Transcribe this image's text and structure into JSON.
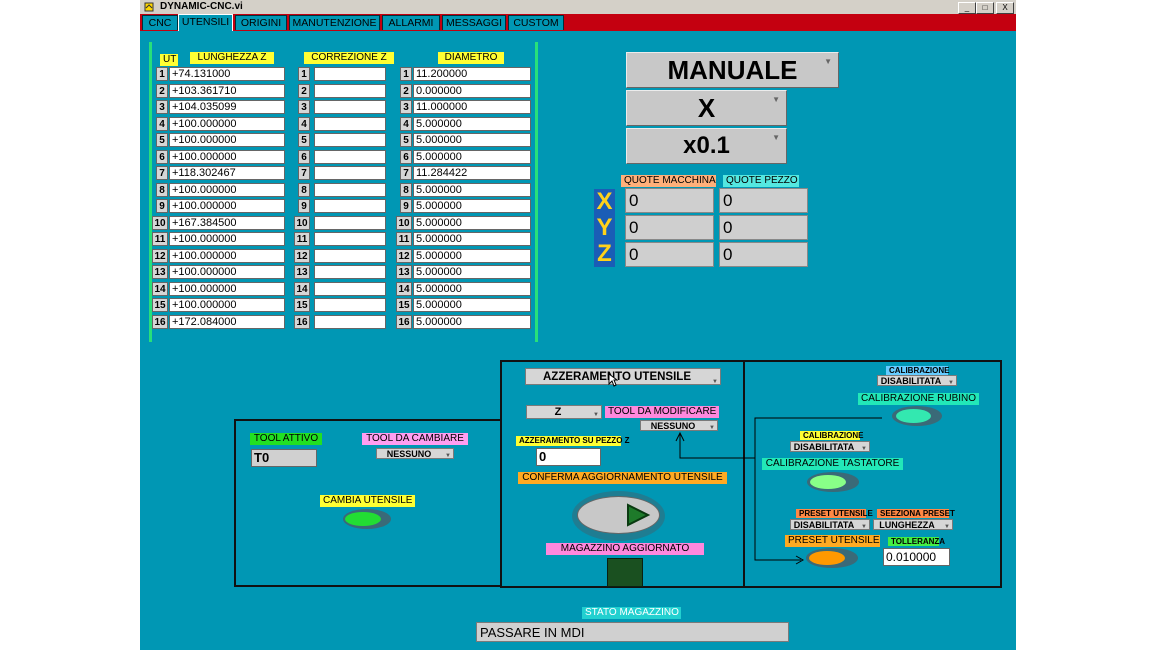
{
  "window": {
    "title": "DYNAMIC-CNC.vi",
    "min": "_",
    "max": "□",
    "close": "X"
  },
  "tabs": [
    "CNC",
    "UTENSILI",
    "ORIGINI",
    "MANUTENZIONE",
    "ALLARMI",
    "MESSAGGI",
    "CUSTOM"
  ],
  "table": {
    "ut_header": "UT",
    "lunghezza_header": "LUNGHEZZA Z",
    "correzione_header": "CORREZIONE Z",
    "diametro_header": "DIAMETRO",
    "rows": [
      {
        "n": "1",
        "len": "+74.131000",
        "corr": "",
        "dia": "11.200000"
      },
      {
        "n": "2",
        "len": "+103.361710",
        "corr": "",
        "dia": "0.000000"
      },
      {
        "n": "3",
        "len": "+104.035099",
        "corr": "",
        "dia": "11.000000"
      },
      {
        "n": "4",
        "len": "+100.000000",
        "corr": "",
        "dia": "5.000000"
      },
      {
        "n": "5",
        "len": "+100.000000",
        "corr": "",
        "dia": "5.000000"
      },
      {
        "n": "6",
        "len": "+100.000000",
        "corr": "",
        "dia": "5.000000"
      },
      {
        "n": "7",
        "len": "+118.302467",
        "corr": "",
        "dia": "11.284422"
      },
      {
        "n": "8",
        "len": "+100.000000",
        "corr": "",
        "dia": "5.000000"
      },
      {
        "n": "9",
        "len": "+100.000000",
        "corr": "",
        "dia": "5.000000"
      },
      {
        "n": "10",
        "len": "+167.384500",
        "corr": "",
        "dia": "5.000000"
      },
      {
        "n": "11",
        "len": "+100.000000",
        "corr": "",
        "dia": "5.000000"
      },
      {
        "n": "12",
        "len": "+100.000000",
        "corr": "",
        "dia": "5.000000"
      },
      {
        "n": "13",
        "len": "+100.000000",
        "corr": "",
        "dia": "5.000000"
      },
      {
        "n": "14",
        "len": "+100.000000",
        "corr": "",
        "dia": "5.000000"
      },
      {
        "n": "15",
        "len": "+100.000000",
        "corr": "",
        "dia": "5.000000"
      },
      {
        "n": "16",
        "len": "+172.084000",
        "corr": "",
        "dia": "5.000000"
      }
    ]
  },
  "mode": {
    "mode": "MANUALE",
    "axis": "X",
    "step": "x0.1"
  },
  "quote": {
    "macchina_label": "QUOTE MACCHINA",
    "pezzo_label": "QUOTE PEZZO",
    "axes": [
      "X",
      "Y",
      "Z"
    ],
    "macchina": [
      "0",
      "0",
      "0"
    ],
    "pezzo": [
      "0",
      "0",
      "0"
    ]
  },
  "tool_change": {
    "attivo_label": "TOOL ATTIVO",
    "attivo_value": "T0",
    "da_cambiare_label": "TOOL DA CAMBIARE",
    "da_cambiare_value": "NESSUNO",
    "cambia_label": "CAMBIA UTENSILE"
  },
  "azzeramento": {
    "mode_value": "AZZERAMENTO UTENSILE",
    "axis_value": "Z",
    "da_modificare_label": "TOOL DA MODIFICARE",
    "da_modificare_value": "NESSUNO",
    "pezzo_label": "AZZERAMENTO SU PEZZO Z",
    "pezzo_value": "0",
    "conferma_label": "CONFERMA AGGIORNAMENTO UTENSILE",
    "magazzino_label": "MAGAZZINO AGGIORNATO"
  },
  "calibrazione": {
    "cal1_label": "CALIBRAZIONE",
    "cal1_value": "DISABILITATA",
    "rubino_label": "CALIBRAZIONE RUBINO",
    "cal2_label": "CALIBRAZIONE",
    "cal2_value": "DISABILITATA",
    "tastatore_label": "CALIBRAZIONE TASTATORE",
    "preset_label": "PRESET UTENSILE",
    "preset_value": "DISABILITATA",
    "sezione_label": "SEEZIONA PRESET",
    "sezione_value": "LUNGHEZZA",
    "preset_button_label": "PRESET UTENSILE",
    "tolleranza_label": "TOLLERANZA",
    "tolleranza_value": "0.010000"
  },
  "stato": {
    "label": "STATO MAGAZZINO",
    "value": "PASSARE IN MDI"
  },
  "colors": {
    "background": "#0097b4",
    "tabbar": "#c40010",
    "led_green": "#22dd33",
    "led_orange": "#ff9900",
    "accent_yellow": "#ffff33"
  }
}
